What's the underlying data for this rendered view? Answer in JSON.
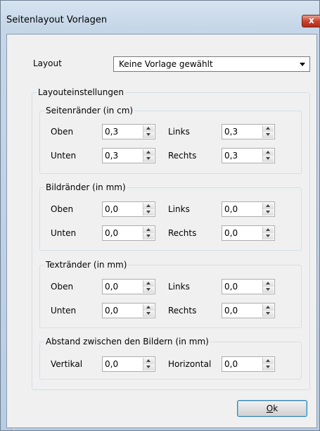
{
  "window": {
    "title": "Seitenlayout Vorlagen",
    "close_glyph": "x"
  },
  "layout": {
    "label": "Layout",
    "selected": "Keine Vorlage gewählt"
  },
  "settings": {
    "title": "Layouteinstellungen",
    "page_margins": {
      "title": "Seitenränder (in cm)",
      "oben_label": "Oben",
      "oben_value": "0,3",
      "links_label": "Links",
      "links_value": "0,3",
      "unten_label": "Unten",
      "unten_value": "0,3",
      "rechts_label": "Rechts",
      "rechts_value": "0,3"
    },
    "image_margins": {
      "title": "Bildränder (in mm)",
      "oben_label": "Oben",
      "oben_value": "0,0",
      "links_label": "Links",
      "links_value": "0,0",
      "unten_label": "Unten",
      "unten_value": "0,0",
      "rechts_label": "Rechts",
      "rechts_value": "0,0"
    },
    "text_margins": {
      "title": "Textränder (in mm)",
      "oben_label": "Oben",
      "oben_value": "0,0",
      "links_label": "Links",
      "links_value": "0,0",
      "unten_label": "Unten",
      "unten_value": "0,0",
      "rechts_label": "Rechts",
      "rechts_value": "0,0"
    },
    "spacing": {
      "title": "Abstand zwischen den Bildern (in mm)",
      "vertical_label": "Vertikal",
      "vertical_value": "0,0",
      "horizontal_label": "Horizontal",
      "horizontal_value": "0,0"
    }
  },
  "ok_button": {
    "mnemonic": "O",
    "rest": "k"
  }
}
